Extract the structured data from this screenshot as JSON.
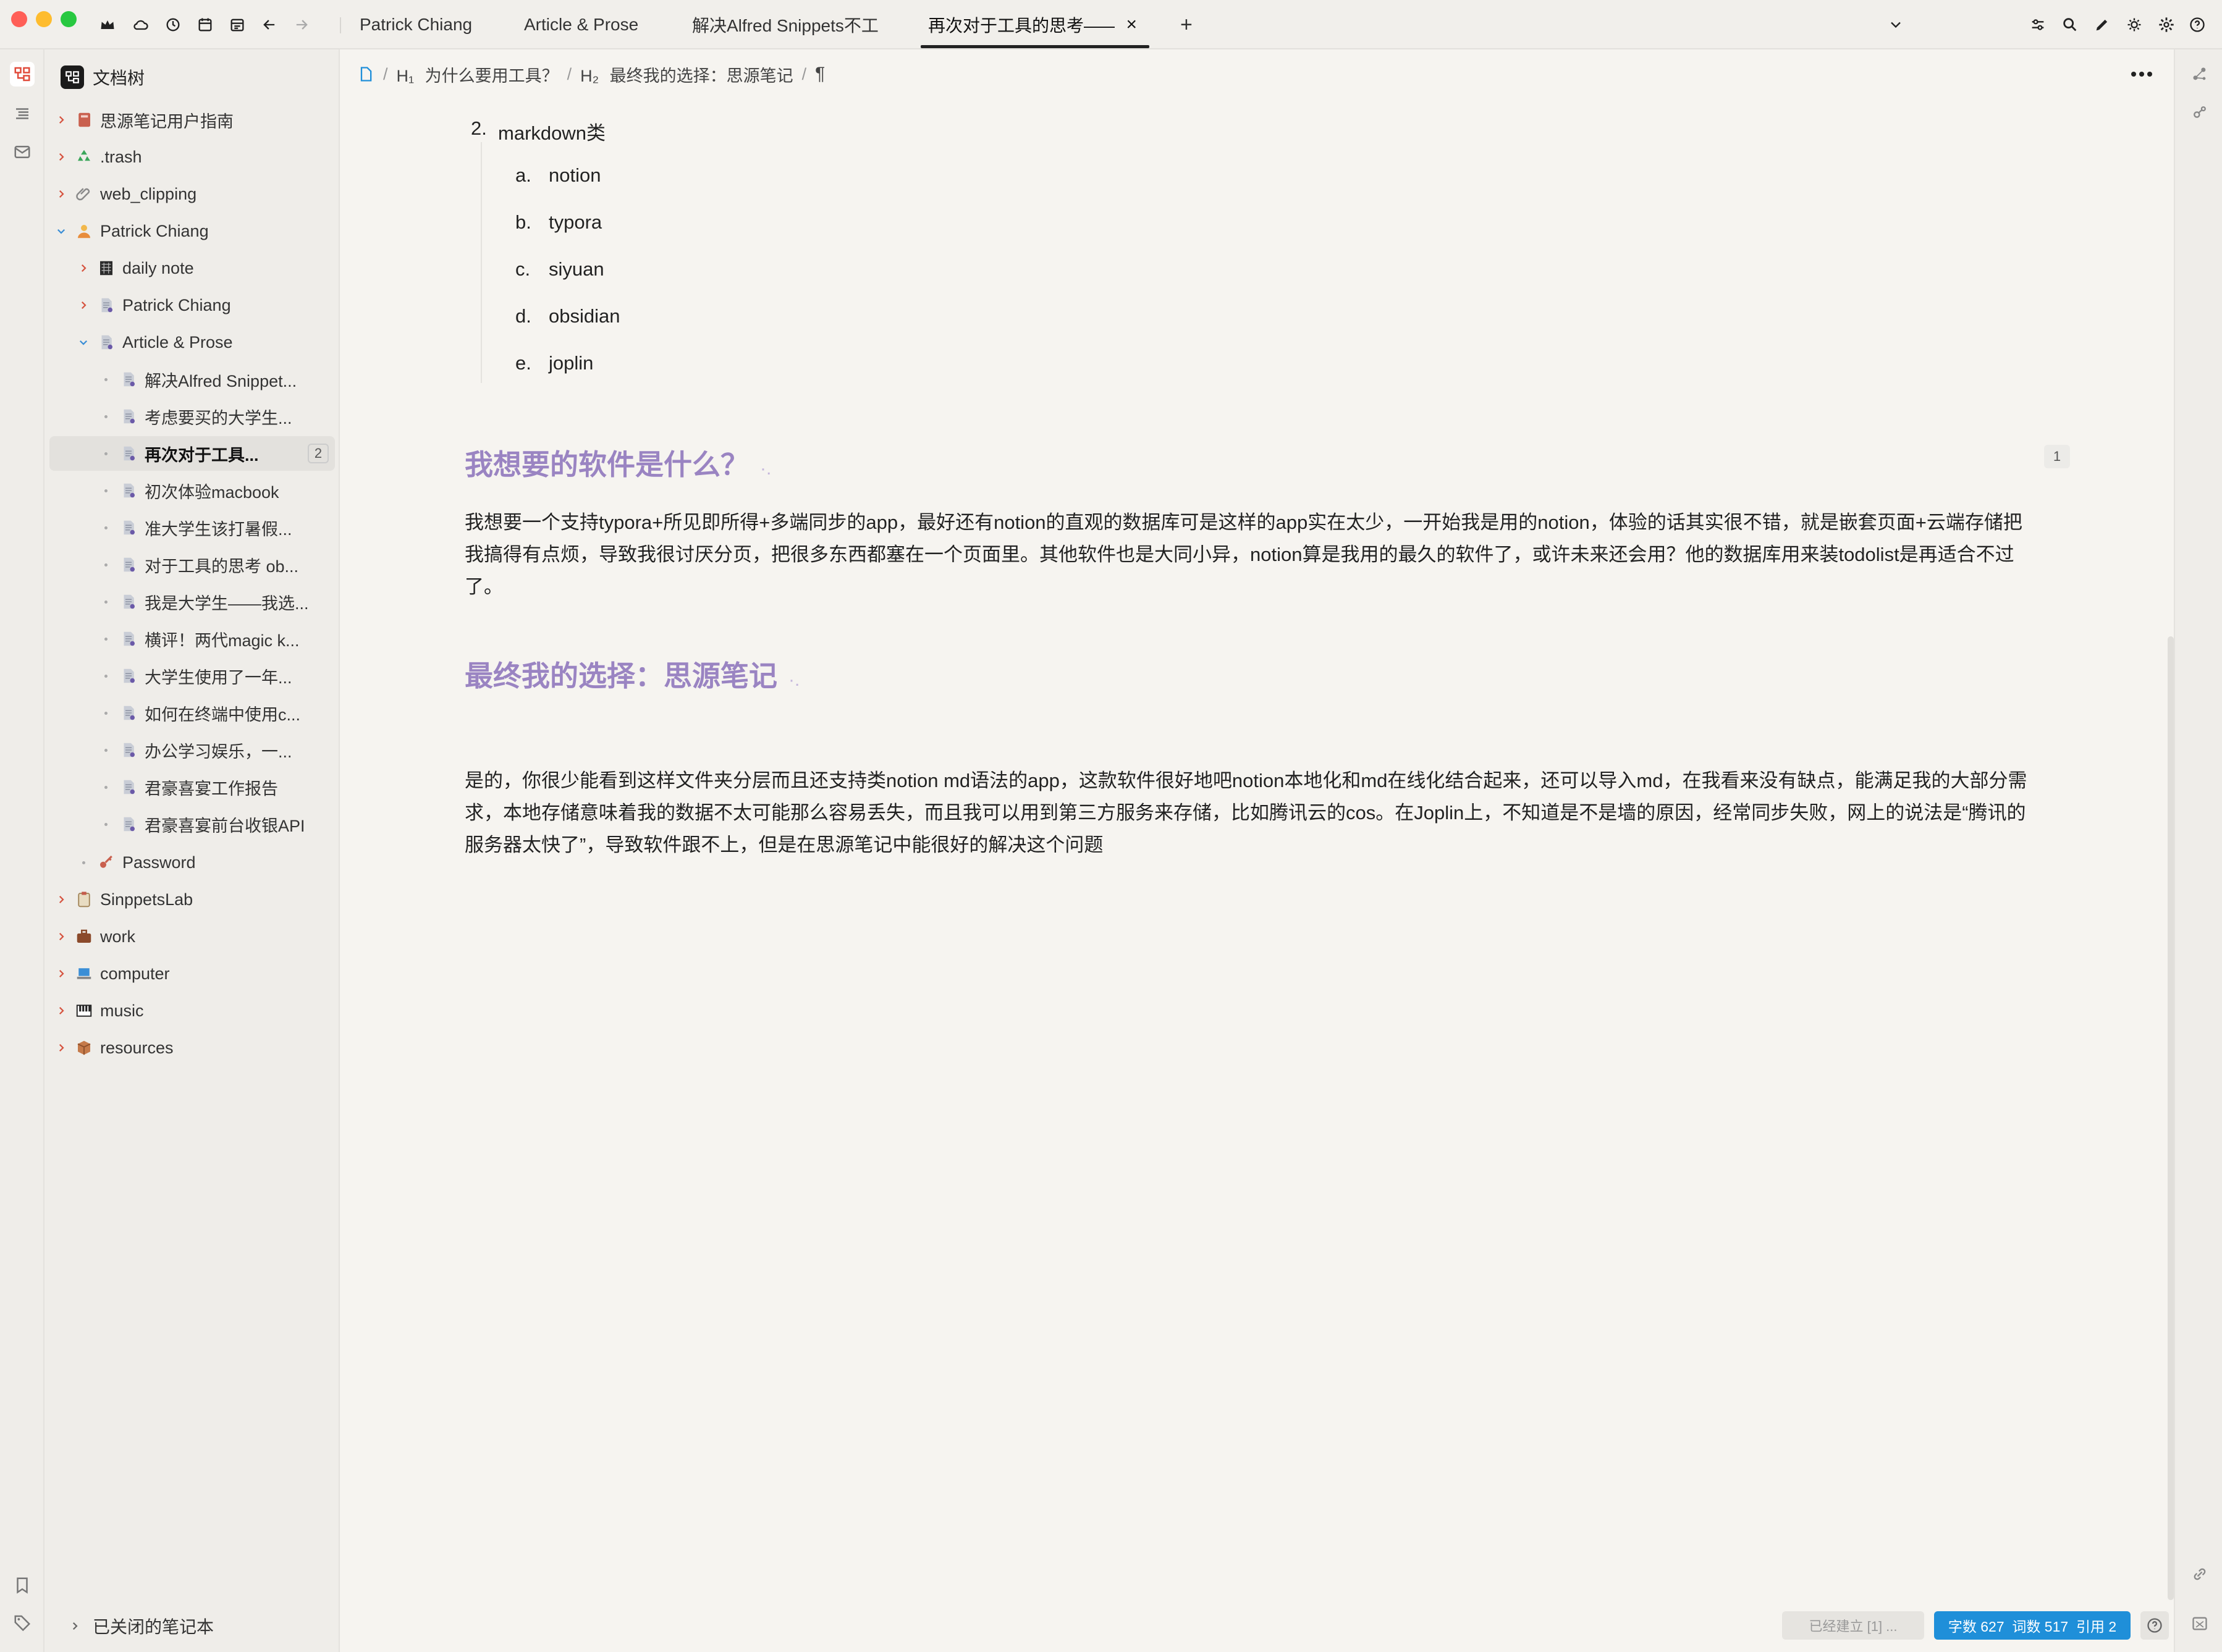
{
  "colors": {
    "accent_heading": "#9a84c2",
    "status_blue": "#1f8fd9",
    "traffic_red": "#ff5f57",
    "traffic_yellow": "#febc2e",
    "traffic_green": "#28c840"
  },
  "titlebar": {
    "icons": [
      "crown-icon",
      "cloud-icon",
      "history-icon",
      "calendar-icon",
      "calendar-alt-icon",
      "back-icon",
      "forward-icon"
    ],
    "tabs": [
      {
        "label": "Patrick Chiang"
      },
      {
        "label": "Article & Prose"
      },
      {
        "label": "解决Alfred Snippets不工"
      },
      {
        "label": "再次对于工具的思考——J"
      }
    ],
    "add_tab": "+",
    "close_tab": "×",
    "right_icons": [
      "sliders-icon",
      "search-icon",
      "pen-icon",
      "sun-icon",
      "gear-icon",
      "help-icon"
    ]
  },
  "sidebar": {
    "title": "文档树",
    "items": [
      {
        "label": "思源笔记用户指南",
        "icon": "book-icon"
      },
      {
        "label": ".trash",
        "icon": "recycle-icon"
      },
      {
        "label": "web_clipping",
        "icon": "paperclip-icon"
      },
      {
        "label": "Patrick Chiang",
        "icon": "person-icon"
      },
      {
        "label": "daily note",
        "icon": "calendar-doc-icon"
      },
      {
        "label": "Patrick Chiang",
        "icon": "doc-icon"
      },
      {
        "label": "Article & Prose",
        "icon": "doc-icon"
      },
      {
        "label": "解决Alfred Snippet...",
        "icon": "doc-icon"
      },
      {
        "label": "考虑要买的大学生...",
        "icon": "doc-icon"
      },
      {
        "label": "再次对于工具...",
        "icon": "doc-icon",
        "badge": "2"
      },
      {
        "label": "初次体验macbook",
        "icon": "doc-icon"
      },
      {
        "label": "准大学生该打暑假...",
        "icon": "doc-icon"
      },
      {
        "label": "对于工具的思考 ob...",
        "icon": "doc-icon"
      },
      {
        "label": "我是大学生——我选...",
        "icon": "doc-icon"
      },
      {
        "label": "横评！两代magic k...",
        "icon": "doc-icon"
      },
      {
        "label": "大学生使用了一年...",
        "icon": "doc-icon"
      },
      {
        "label": "如何在终端中使用c...",
        "icon": "doc-icon"
      },
      {
        "label": "办公学习娱乐，一...",
        "icon": "doc-icon"
      },
      {
        "label": "君豪喜宴工作报告",
        "icon": "doc-icon"
      },
      {
        "label": "君豪喜宴前台收银API",
        "icon": "doc-icon"
      },
      {
        "label": "Password",
        "icon": "key-icon"
      },
      {
        "label": "SinppetsLab",
        "icon": "clipboard-icon"
      },
      {
        "label": "work",
        "icon": "briefcase-icon"
      },
      {
        "label": "computer",
        "icon": "laptop-icon"
      },
      {
        "label": "music",
        "icon": "piano-icon"
      },
      {
        "label": "resources",
        "icon": "package-icon"
      }
    ],
    "closed_notebooks": "已关闭的笔记本"
  },
  "breadcrumb": {
    "h1_marker": "H₁",
    "h1_label": "为什么要用工具？",
    "h2_marker": "H₂",
    "h2_label": "最终我的选择：思源笔记",
    "pilcrow": "¶",
    "separator": "/"
  },
  "document": {
    "list_number": "2.",
    "list_title": "markdown类",
    "sub_items": [
      {
        "marker": "a.",
        "text": "notion"
      },
      {
        "marker": "b.",
        "text": "typora"
      },
      {
        "marker": "c.",
        "text": "siyuan"
      },
      {
        "marker": "d.",
        "text": "obsidian"
      },
      {
        "marker": "e.",
        "text": "joplin"
      }
    ],
    "heading1": "我想要的软件是什么？",
    "heading_anchor": "·.",
    "heading1_ref_count": "1",
    "paragraph1": "我想要一个支持typora+所见即所得+多端同步的app，最好还有notion的直观的数据库可是这样的app实在太少，一开始我是用的notion，体验的话其实很不错，就是嵌套页面+云端存储把我搞得有点烦，导致我很讨厌分页，把很多东西都塞在一个页面里。其他软件也是大同小异，notion算是我用的最久的软件了，或许未来还会用？他的数据库用来装todolist是再适合不过了。",
    "heading2": "最终我的选择：思源笔记",
    "paragraph2": "是的，你很少能看到这样文件夹分层而且还支持类notion md语法的app，这款软件很好地吧notion本地化和md在线化结合起来，还可以导入md，在我看来没有缺点，能满足我的大部分需求，本地存储意味着我的数据不太可能那么容易丢失，而且我可以用到第三方服务来存储，比如腾讯云的cos。在Joplin上，不知道是不是墙的原因，经常同步失败，网上的说法是“腾讯的服务器太快了”，导致软件跟不上，但是在思源笔记中能很好的解决这个问题"
  },
  "status": {
    "backlinks": "已经建立 [1] ...",
    "count": "字数 627  词数 517  引用 2",
    "help": "?"
  }
}
